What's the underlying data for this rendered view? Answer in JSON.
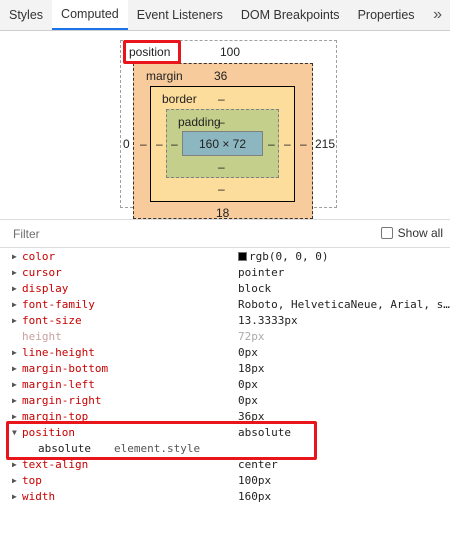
{
  "tabs": [
    {
      "label": "Styles",
      "active": false
    },
    {
      "label": "Computed",
      "active": true
    },
    {
      "label": "Event Listeners",
      "active": false
    },
    {
      "label": "DOM Breakpoints",
      "active": false
    },
    {
      "label": "Properties",
      "active": false
    }
  ],
  "more_tabs_glyph": "»",
  "box_model": {
    "position_label": "position",
    "position_top": "100",
    "position_left": "0",
    "position_right": "215",
    "margin_label": "margin",
    "margin_top": "36",
    "margin_bottom": "18",
    "margin_left": "–",
    "margin_right": "–",
    "border_label": "border",
    "border_top": "–",
    "border_bottom": "–",
    "border_left": "–",
    "border_right": "–",
    "padding_label": "padding",
    "padding_top": "–",
    "padding_bottom": "–",
    "padding_left": "–",
    "padding_right": "–",
    "content_size": "160 × 72"
  },
  "filter": {
    "placeholder": "Filter",
    "show_all_label": "Show all"
  },
  "properties": [
    {
      "name": "color",
      "value": "rgb(0, 0, 0)",
      "swatch": "#000000",
      "inherited": false
    },
    {
      "name": "cursor",
      "value": "pointer",
      "inherited": false
    },
    {
      "name": "display",
      "value": "block",
      "inherited": false
    },
    {
      "name": "font-family",
      "value": "Roboto, HelveticaNeue, Arial, s…",
      "inherited": false
    },
    {
      "name": "font-size",
      "value": "13.3333px",
      "inherited": false
    },
    {
      "name": "height",
      "value": "72px",
      "inherited": true
    },
    {
      "name": "line-height",
      "value": "0px",
      "inherited": false
    },
    {
      "name": "margin-bottom",
      "value": "18px",
      "inherited": false
    },
    {
      "name": "margin-left",
      "value": "0px",
      "inherited": false
    },
    {
      "name": "margin-right",
      "value": "0px",
      "inherited": false
    },
    {
      "name": "margin-top",
      "value": "36px",
      "inherited": false
    },
    {
      "name": "position",
      "value": "absolute",
      "inherited": false,
      "expanded": true,
      "sub_value": "absolute",
      "sub_source": "element.style"
    },
    {
      "name": "text-align",
      "value": "center",
      "inherited": false
    },
    {
      "name": "top",
      "value": "100px",
      "inherited": false
    },
    {
      "name": "width",
      "value": "160px",
      "inherited": false
    }
  ],
  "colors": {
    "accent": "#1a73e8",
    "highlight": "#e8151b",
    "margin": "#f8cb9c",
    "border": "#fddd9b",
    "padding": "#c3cf8a",
    "content": "#8cb6c0"
  }
}
